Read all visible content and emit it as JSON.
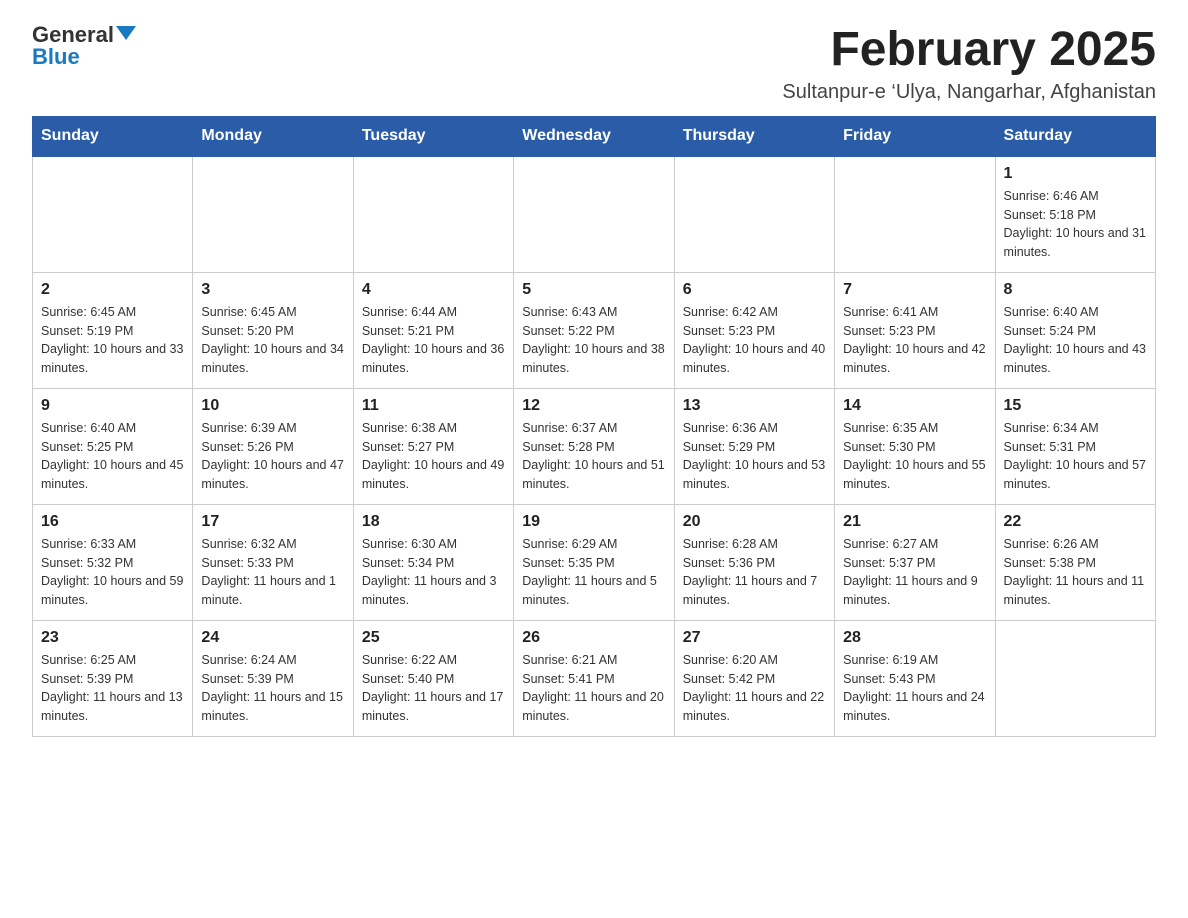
{
  "logo": {
    "general": "General",
    "blue": "Blue"
  },
  "header": {
    "month": "February 2025",
    "location": "Sultanpur-e ‘Ulya, Nangarhar, Afghanistan"
  },
  "weekdays": [
    "Sunday",
    "Monday",
    "Tuesday",
    "Wednesday",
    "Thursday",
    "Friday",
    "Saturday"
  ],
  "weeks": [
    [
      {
        "day": "",
        "info": ""
      },
      {
        "day": "",
        "info": ""
      },
      {
        "day": "",
        "info": ""
      },
      {
        "day": "",
        "info": ""
      },
      {
        "day": "",
        "info": ""
      },
      {
        "day": "",
        "info": ""
      },
      {
        "day": "1",
        "info": "Sunrise: 6:46 AM\nSunset: 5:18 PM\nDaylight: 10 hours and 31 minutes."
      }
    ],
    [
      {
        "day": "2",
        "info": "Sunrise: 6:45 AM\nSunset: 5:19 PM\nDaylight: 10 hours and 33 minutes."
      },
      {
        "day": "3",
        "info": "Sunrise: 6:45 AM\nSunset: 5:20 PM\nDaylight: 10 hours and 34 minutes."
      },
      {
        "day": "4",
        "info": "Sunrise: 6:44 AM\nSunset: 5:21 PM\nDaylight: 10 hours and 36 minutes."
      },
      {
        "day": "5",
        "info": "Sunrise: 6:43 AM\nSunset: 5:22 PM\nDaylight: 10 hours and 38 minutes."
      },
      {
        "day": "6",
        "info": "Sunrise: 6:42 AM\nSunset: 5:23 PM\nDaylight: 10 hours and 40 minutes."
      },
      {
        "day": "7",
        "info": "Sunrise: 6:41 AM\nSunset: 5:23 PM\nDaylight: 10 hours and 42 minutes."
      },
      {
        "day": "8",
        "info": "Sunrise: 6:40 AM\nSunset: 5:24 PM\nDaylight: 10 hours and 43 minutes."
      }
    ],
    [
      {
        "day": "9",
        "info": "Sunrise: 6:40 AM\nSunset: 5:25 PM\nDaylight: 10 hours and 45 minutes."
      },
      {
        "day": "10",
        "info": "Sunrise: 6:39 AM\nSunset: 5:26 PM\nDaylight: 10 hours and 47 minutes."
      },
      {
        "day": "11",
        "info": "Sunrise: 6:38 AM\nSunset: 5:27 PM\nDaylight: 10 hours and 49 minutes."
      },
      {
        "day": "12",
        "info": "Sunrise: 6:37 AM\nSunset: 5:28 PM\nDaylight: 10 hours and 51 minutes."
      },
      {
        "day": "13",
        "info": "Sunrise: 6:36 AM\nSunset: 5:29 PM\nDaylight: 10 hours and 53 minutes."
      },
      {
        "day": "14",
        "info": "Sunrise: 6:35 AM\nSunset: 5:30 PM\nDaylight: 10 hours and 55 minutes."
      },
      {
        "day": "15",
        "info": "Sunrise: 6:34 AM\nSunset: 5:31 PM\nDaylight: 10 hours and 57 minutes."
      }
    ],
    [
      {
        "day": "16",
        "info": "Sunrise: 6:33 AM\nSunset: 5:32 PM\nDaylight: 10 hours and 59 minutes."
      },
      {
        "day": "17",
        "info": "Sunrise: 6:32 AM\nSunset: 5:33 PM\nDaylight: 11 hours and 1 minute."
      },
      {
        "day": "18",
        "info": "Sunrise: 6:30 AM\nSunset: 5:34 PM\nDaylight: 11 hours and 3 minutes."
      },
      {
        "day": "19",
        "info": "Sunrise: 6:29 AM\nSunset: 5:35 PM\nDaylight: 11 hours and 5 minutes."
      },
      {
        "day": "20",
        "info": "Sunrise: 6:28 AM\nSunset: 5:36 PM\nDaylight: 11 hours and 7 minutes."
      },
      {
        "day": "21",
        "info": "Sunrise: 6:27 AM\nSunset: 5:37 PM\nDaylight: 11 hours and 9 minutes."
      },
      {
        "day": "22",
        "info": "Sunrise: 6:26 AM\nSunset: 5:38 PM\nDaylight: 11 hours and 11 minutes."
      }
    ],
    [
      {
        "day": "23",
        "info": "Sunrise: 6:25 AM\nSunset: 5:39 PM\nDaylight: 11 hours and 13 minutes."
      },
      {
        "day": "24",
        "info": "Sunrise: 6:24 AM\nSunset: 5:39 PM\nDaylight: 11 hours and 15 minutes."
      },
      {
        "day": "25",
        "info": "Sunrise: 6:22 AM\nSunset: 5:40 PM\nDaylight: 11 hours and 17 minutes."
      },
      {
        "day": "26",
        "info": "Sunrise: 6:21 AM\nSunset: 5:41 PM\nDaylight: 11 hours and 20 minutes."
      },
      {
        "day": "27",
        "info": "Sunrise: 6:20 AM\nSunset: 5:42 PM\nDaylight: 11 hours and 22 minutes."
      },
      {
        "day": "28",
        "info": "Sunrise: 6:19 AM\nSunset: 5:43 PM\nDaylight: 11 hours and 24 minutes."
      },
      {
        "day": "",
        "info": ""
      }
    ]
  ]
}
